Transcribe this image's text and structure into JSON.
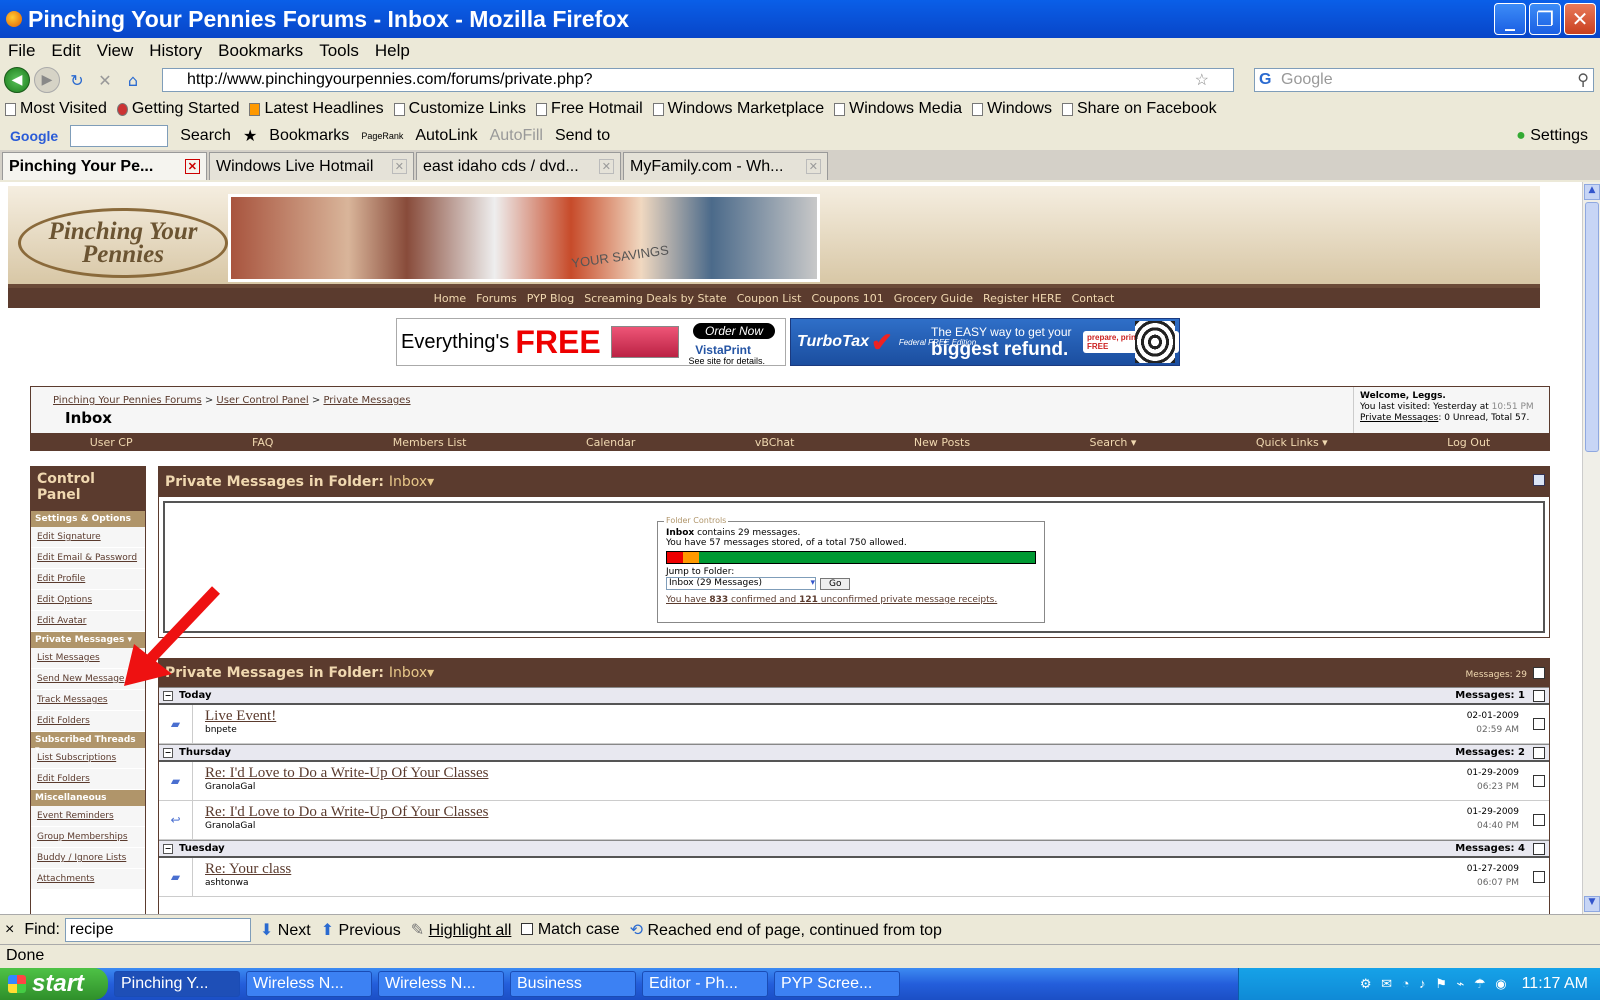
{
  "window": {
    "title": "Pinching Your Pennies Forums - Inbox - Mozilla Firefox"
  },
  "menu": [
    "File",
    "Edit",
    "View",
    "History",
    "Bookmarks",
    "Tools",
    "Help"
  ],
  "nav": {
    "url": "http://www.pinchingyourpennies.com/forums/private.php?",
    "search_placeholder": "Google"
  },
  "bookmarks": [
    "Most Visited",
    "Getting Started",
    "Latest Headlines",
    "Customize Links",
    "Free Hotmail",
    "Windows Marketplace",
    "Windows Media",
    "Windows",
    "Share on Facebook"
  ],
  "google_toolbar": {
    "logo": "Google",
    "search": "Search",
    "bookmarks": "Bookmarks",
    "pagerank": "PageRank",
    "autolink": "AutoLink",
    "autofill": "AutoFill",
    "sendto": "Send to",
    "settings": "Settings"
  },
  "tabs": [
    "Pinching Your Pe...",
    "Windows Live Hotmail",
    "east idaho cds / dvd...",
    "MyFamily.com - Wh..."
  ],
  "site": {
    "logo_line1": "Pinching Your",
    "logo_line2": "Pennies",
    "banner_text": "YOUR SAVINGS",
    "topnav": [
      "Home",
      "Forums",
      "PYP Blog",
      "Screaming Deals by State",
      "Coupon List",
      "Coupons 101",
      "Grocery Guide",
      "Register HERE",
      "Contact"
    ],
    "ad1": {
      "text": "Everything's",
      "free": "FREE",
      "order": "Order Now",
      "brand": "VistaPrint",
      "small": "See site for details."
    },
    "ad2": {
      "brand": "TurboTax",
      "edition": "Federal FREE Edition",
      "msg": "The EASY way to get your",
      "big": "biggest refund.",
      "btn": "prepare, print & e-file FREE"
    },
    "crumbs": [
      "Pinching Your Pennies Forums",
      "User Control Panel",
      "Private Messages"
    ],
    "page_title": "Inbox",
    "welcome": {
      "line1": "Welcome, Leggs.",
      "line2": "You last visited: Yesterday at",
      "time": "10:51 PM",
      "pm_link": "Private Messages",
      "pm_stats": ": 0 Unread, Total 57."
    },
    "subnav": [
      "User CP",
      "FAQ",
      "Members List",
      "Calendar",
      "vBChat",
      "New Posts",
      "Search",
      "Quick Links",
      "Log Out"
    ]
  },
  "sidebar": {
    "title": "Control Panel",
    "settings_header": "Settings & Options",
    "settings": [
      "Edit Signature",
      "Edit Email & Password",
      "Edit Profile",
      "Edit Options",
      "Edit Avatar"
    ],
    "pm_header": "Private Messages",
    "pm": [
      "List Messages",
      "Send New Message",
      "Track Messages",
      "Edit Folders"
    ],
    "subs_header": "Subscribed Threads",
    "subs": [
      "List Subscriptions",
      "Edit Folders"
    ],
    "misc_header": "Miscellaneous",
    "misc": [
      "Event Reminders",
      "Group Memberships",
      "Buddy / Ignore Lists",
      "Attachments"
    ]
  },
  "pm_panel": {
    "heading": "Private Messages in Folder",
    "folder": "Inbox",
    "legend": "Folder Controls",
    "inbox_label": "Inbox",
    "contains": "contains 29 messages.",
    "stored": "You have 57 messages stored, of a total 750 allowed.",
    "storage_used": 0.076,
    "jump_label": "Jump to Folder:",
    "jump_value": "Inbox (29 Messages)",
    "go": "Go",
    "rec_pre": "You have",
    "rec_confirmed": "833",
    "rec_mid": "confirmed and",
    "rec_unconfirmed": "121",
    "rec_post": "unconfirmed private message receipts."
  },
  "message_list": {
    "heading": "Private Messages in Folder",
    "folder": "Inbox",
    "count": "Messages: 29",
    "groups": [
      {
        "label": "Today",
        "count": "Messages: 1",
        "messages": [
          {
            "subject": "Live Event!",
            "from": "bnpete",
            "date": "02-01-2009",
            "time": "02:59 AM"
          }
        ]
      },
      {
        "label": "Thursday",
        "count": "Messages: 2",
        "messages": [
          {
            "subject": "Re: I'd Love to Do a Write-Up Of Your Classes",
            "from": "GranolaGal",
            "date": "01-29-2009",
            "time": "06:23 PM"
          },
          {
            "subject": "Re: I'd Love to Do a Write-Up Of Your Classes",
            "from": "GranolaGal",
            "date": "01-29-2009",
            "time": "04:40 PM"
          }
        ]
      },
      {
        "label": "Tuesday",
        "count": "Messages: 4",
        "messages": [
          {
            "subject": "Re: Your class",
            "from": "ashtonwa",
            "date": "01-27-2009",
            "time": "06:07 PM"
          }
        ]
      }
    ]
  },
  "findbar": {
    "label": "Find:",
    "value": "recipe",
    "next": "Next",
    "previous": "Previous",
    "highlight": "Highlight all",
    "match": "Match case",
    "status": "Reached end of page, continued from top"
  },
  "status": "Done",
  "taskbar": {
    "start": "start",
    "items": [
      "Pinching Y...",
      "Wireless N...",
      "Wireless N...",
      "Business",
      "Editor - Ph...",
      "PYP Scree..."
    ],
    "clock": "11:17 AM"
  },
  "colors": {
    "forum_brown": "#5b3b2e",
    "tan": "#b0956a",
    "xp_blue": "#245edb",
    "arrow_red": "#ee1111"
  }
}
